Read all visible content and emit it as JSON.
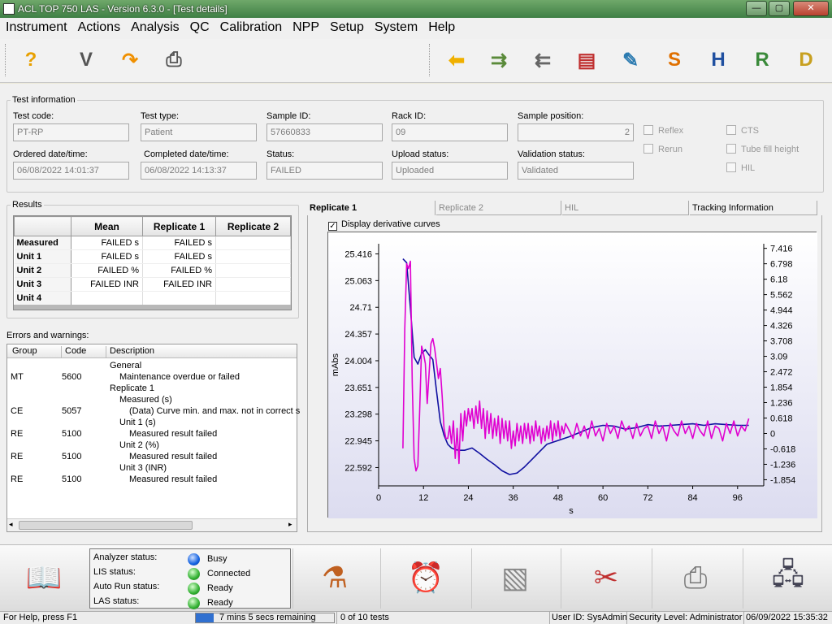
{
  "window": {
    "title": "ACL TOP 750 LAS - Version 6.3.0 - [Test details]",
    "minimize": "—",
    "maximize": "▢",
    "close": "✕"
  },
  "menu": [
    "Instrument",
    "Actions",
    "Analysis",
    "QC",
    "Calibration",
    "NPP",
    "Setup",
    "System",
    "Help"
  ],
  "toolbar": {
    "left": [
      {
        "icon": "help-icon",
        "glyph": "?",
        "color": "#e8a000"
      },
      {
        "icon": "validate-icon",
        "glyph": "V",
        "color": "#555"
      },
      {
        "icon": "redo-arrow-icon",
        "glyph": "↷",
        "color": "#f09000"
      },
      {
        "icon": "printer-icon",
        "glyph": "⎙",
        "color": "#555"
      }
    ],
    "right": [
      {
        "icon": "back-arrow-icon",
        "glyph": "⬅",
        "color": "#f0b000"
      },
      {
        "icon": "rack-forward-icon",
        "glyph": "⇉",
        "color": "#5a8a3a"
      },
      {
        "icon": "rack-back-icon",
        "glyph": "⇇",
        "color": "#666"
      },
      {
        "icon": "report-icon",
        "glyph": "▤",
        "color": "#c03030"
      },
      {
        "icon": "edit-report-icon",
        "glyph": "✎",
        "color": "#2a7ab0"
      },
      {
        "icon": "s-icon",
        "glyph": "S",
        "color": "#e07000"
      },
      {
        "icon": "h-icon",
        "glyph": "H",
        "color": "#2050a0"
      },
      {
        "icon": "r-icon",
        "glyph": "R",
        "color": "#3a8a3a"
      },
      {
        "icon": "d-icon",
        "glyph": "D",
        "color": "#c8a020"
      }
    ]
  },
  "test_info": {
    "legend": "Test information",
    "test_code": {
      "label": "Test code:",
      "value": "PT-RP"
    },
    "test_type": {
      "label": "Test type:",
      "value": "Patient"
    },
    "sample_id": {
      "label": "Sample ID:",
      "value": "57660833"
    },
    "rack_id": {
      "label": "Rack ID:",
      "value": "09"
    },
    "sample_position": {
      "label": "Sample position:",
      "value": "2"
    },
    "ordered": {
      "label": "Ordered date/time:",
      "value": "06/08/2022 14:01:37"
    },
    "completed": {
      "label": "Completed date/time:",
      "value": "06/08/2022 14:13:37"
    },
    "status": {
      "label": "Status:",
      "value": "FAILED"
    },
    "upload": {
      "label": "Upload status:",
      "value": "Uploaded"
    },
    "validation": {
      "label": "Validation status:",
      "value": "Validated"
    },
    "checks": {
      "reflex": "Reflex",
      "rerun": "Rerun",
      "cts": "CTS",
      "tube_fill": "Tube fill height",
      "hil": "HIL"
    }
  },
  "results": {
    "legend": "Results",
    "columns": [
      "",
      "Mean",
      "Replicate 1",
      "Replicate 2"
    ],
    "rows": [
      {
        "name": "Measured",
        "mean": "FAILED s",
        "rep1": "FAILED s",
        "rep2": ""
      },
      {
        "name": "Unit 1",
        "mean": "FAILED s",
        "rep1": "FAILED s",
        "rep2": ""
      },
      {
        "name": "Unit 2",
        "mean": "FAILED %",
        "rep1": "FAILED %",
        "rep2": ""
      },
      {
        "name": "Unit 3",
        "mean": "FAILED INR",
        "rep1": "FAILED INR",
        "rep2": ""
      },
      {
        "name": "Unit 4",
        "mean": "",
        "rep1": "",
        "rep2": ""
      }
    ]
  },
  "errors": {
    "title": "Errors and warnings:",
    "columns": [
      "Group",
      "Code",
      "Description"
    ],
    "rows": [
      {
        "group": "",
        "code": "",
        "desc": "General",
        "indent": 0
      },
      {
        "group": "MT",
        "code": "5600",
        "desc": "Maintenance overdue or failed",
        "indent": 1
      },
      {
        "group": "",
        "code": "",
        "desc": "Replicate 1",
        "indent": 0
      },
      {
        "group": "",
        "code": "",
        "desc": "Measured (s)",
        "indent": 1
      },
      {
        "group": "CE",
        "code": "5057",
        "desc": "(Data) Curve min. and max. not in correct s",
        "indent": 2
      },
      {
        "group": "",
        "code": "",
        "desc": "Unit 1 (s)",
        "indent": 1
      },
      {
        "group": "RE",
        "code": "5100",
        "desc": "Measured result failed",
        "indent": 2
      },
      {
        "group": "",
        "code": "",
        "desc": "Unit 2 (%)",
        "indent": 1
      },
      {
        "group": "RE",
        "code": "5100",
        "desc": "Measured result failed",
        "indent": 2
      },
      {
        "group": "",
        "code": "",
        "desc": "Unit 3 (INR)",
        "indent": 1
      },
      {
        "group": "RE",
        "code": "5100",
        "desc": "Measured result failed",
        "indent": 2
      }
    ]
  },
  "tabs": [
    "Replicate 1",
    "Replicate 2",
    "HIL",
    "Tracking Information"
  ],
  "derivative_checkbox": "Display derivative curves",
  "chart_data": {
    "type": "line",
    "xlabel": "s",
    "ylabel": "mAbs",
    "xlim": [
      0,
      103
    ],
    "ylim": [
      22.35,
      25.55
    ],
    "y2lim": [
      -2.1,
      7.6
    ],
    "x_ticks": [
      0,
      12,
      24,
      36,
      48,
      60,
      72,
      84,
      96
    ],
    "y_ticks": [
      "25.416",
      "25.063",
      "24.71",
      "24.357",
      "24.004",
      "23.651",
      "23.298",
      "22.945",
      "22.592"
    ],
    "y2_ticks": [
      "7.416",
      "6.798",
      "6.18",
      "5.562",
      "4.944",
      "4.326",
      "3.708",
      "3.09",
      "2.472",
      "1.854",
      "1.236",
      "0.618",
      "0",
      "-0.618",
      "-1.236",
      "-1.854"
    ],
    "series": [
      {
        "color": "#1010a0",
        "axis": "left",
        "x": [
          6.5,
          7.5,
          8.5,
          9.5,
          10.5,
          11.5,
          12.5,
          13.5,
          14.5,
          15.5,
          16.5,
          17.5,
          18.5,
          19.5,
          20.5,
          21.5,
          23,
          25,
          27,
          29,
          31,
          33,
          35,
          37,
          39,
          41,
          43,
          45,
          48,
          51,
          54,
          57,
          60,
          63,
          66,
          69,
          72,
          75,
          78,
          81,
          84,
          87,
          90,
          93,
          96,
          99
        ],
        "y": [
          25.35,
          25.3,
          24.7,
          24.05,
          23.96,
          24.1,
          24.15,
          24.08,
          24.02,
          23.6,
          23.2,
          23.02,
          22.9,
          22.85,
          22.83,
          22.82,
          22.82,
          22.85,
          22.78,
          22.7,
          22.63,
          22.55,
          22.5,
          22.52,
          22.6,
          22.7,
          22.8,
          22.9,
          22.95,
          23.0,
          23.06,
          23.12,
          23.15,
          23.14,
          23.1,
          23.12,
          23.16,
          23.14,
          23.15,
          23.16,
          23.17,
          23.15,
          23.17,
          23.16,
          23.15,
          23.15
        ]
      },
      {
        "color": "#e000d0",
        "axis": "right",
        "x": [
          6.5,
          7,
          7.5,
          8,
          8.5,
          9,
          9.5,
          10,
          10.5,
          11,
          11.5,
          12,
          12.5,
          13,
          13.5,
          14,
          14.5,
          15,
          15.5,
          16,
          16.5,
          17,
          17.5,
          18,
          18.5,
          19,
          19.5,
          20,
          20.5,
          21,
          21.5,
          22,
          22.5,
          23,
          23.5,
          24,
          24.5,
          25,
          25.5,
          26,
          26.5,
          27,
          27.5,
          28,
          28.5,
          29,
          29.5,
          30,
          30.5,
          31,
          31.5,
          32,
          32.5,
          33,
          33.5,
          34,
          34.5,
          35,
          35.5,
          36,
          36.5,
          37,
          37.5,
          38,
          38.5,
          39,
          39.5,
          40,
          40.5,
          41,
          41.5,
          42,
          42.5,
          43,
          43.5,
          44,
          44.5,
          45,
          45.5,
          46,
          46.5,
          47,
          47.5,
          48,
          48.5,
          49,
          49.5,
          50,
          51,
          52,
          53,
          54,
          55,
          56,
          57,
          58,
          59,
          60,
          61,
          62,
          63,
          64,
          65,
          66,
          67,
          68,
          69,
          70,
          71,
          72,
          73,
          74,
          75,
          76,
          77,
          78,
          79,
          80,
          81,
          82,
          83,
          84,
          85,
          86,
          87,
          88,
          89,
          90,
          91,
          92,
          93,
          94,
          95,
          96,
          97,
          98,
          99
        ],
        "y": [
          -0.6,
          4.2,
          6.8,
          6.6,
          6.9,
          2.0,
          -1.0,
          -1.5,
          -1.3,
          1.0,
          3.5,
          3.2,
          2.8,
          1.2,
          2.4,
          3.6,
          3.8,
          3.4,
          2.8,
          2.2,
          2.6,
          1.5,
          0.2,
          -0.2,
          -0.2,
          0.3,
          -0.4,
          0.5,
          -1.0,
          0.2,
          -1.2,
          0.8,
          -0.3,
          0.9,
          0.3,
          1.0,
          0.5,
          1.0,
          0.2,
          1.1,
          0.4,
          1.3,
          0.2,
          1.0,
          -0.2,
          0.9,
          0.0,
          0.8,
          -0.2,
          0.6,
          -0.1,
          0.7,
          -0.4,
          0.6,
          -0.2,
          0.5,
          -0.3,
          0.5,
          -0.6,
          0.1,
          -0.5,
          0.4,
          -0.3,
          0.3,
          -0.4,
          0.4,
          -0.2,
          0.4,
          -0.4,
          0.3,
          -0.3,
          0.5,
          -0.1,
          0.3,
          -0.4,
          0.2,
          -0.3,
          0.3,
          -0.2,
          0.5,
          -0.3,
          0.4,
          -0.1,
          0.5,
          -0.2,
          0.3,
          0.0,
          0.4,
          0.1,
          -0.2,
          0.4,
          -0.1,
          0.3,
          -0.2,
          0.5,
          -0.1,
          0.2,
          -0.3,
          0.4,
          0.0,
          0.3,
          -0.2,
          0.5,
          0.1,
          0.3,
          -0.2,
          0.4,
          -0.1,
          0.2,
          0.3,
          -0.2,
          0.5,
          0.0,
          0.3,
          -0.3,
          0.4,
          0.1,
          -0.1,
          0.5,
          0.0,
          0.3,
          -0.2,
          0.4,
          0.1,
          -0.1,
          0.5,
          -0.2,
          0.3,
          0.2,
          -0.3,
          0.4,
          0.0,
          0.5,
          -0.1,
          0.3,
          0.1,
          0.6
        ]
      }
    ]
  },
  "bottom": {
    "analyzer": {
      "label": "Analyzer status:",
      "value": "Busy",
      "color": "#1060e0"
    },
    "lis": {
      "label": "LIS status:",
      "value": "Connected",
      "color": "#30b030"
    },
    "autorun": {
      "label": "Auto Run status:",
      "value": "Ready",
      "color": "#30b030"
    },
    "las": {
      "label": "LAS status:",
      "value": "Ready",
      "color": "#30b030"
    },
    "icons": [
      "reagents-icon",
      "maintenance-alarm-icon",
      "report-graph-icon",
      "tools-icon",
      "printer-device-icon",
      "network-icon"
    ]
  },
  "statusbar": {
    "help": "For Help, press F1",
    "progress": "7 mins 5 secs remaining",
    "tests": "0 of 10 tests",
    "user": "User ID: SysAdmin",
    "security": "Security Level: Administrator",
    "datetime": "06/09/2022 15:35:32"
  }
}
